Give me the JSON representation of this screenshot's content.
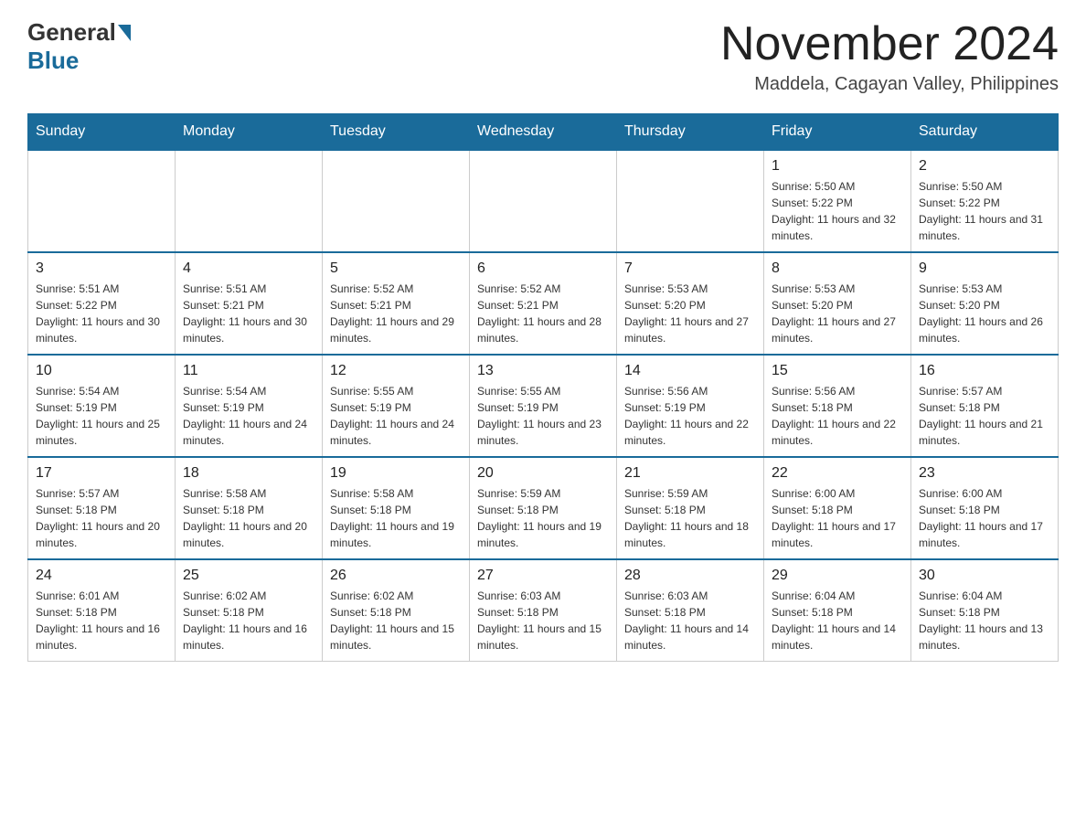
{
  "header": {
    "logo_general": "General",
    "logo_blue": "Blue",
    "month_title": "November 2024",
    "location": "Maddela, Cagayan Valley, Philippines"
  },
  "weekdays": [
    "Sunday",
    "Monday",
    "Tuesday",
    "Wednesday",
    "Thursday",
    "Friday",
    "Saturday"
  ],
  "weeks": [
    [
      {
        "day": "",
        "info": ""
      },
      {
        "day": "",
        "info": ""
      },
      {
        "day": "",
        "info": ""
      },
      {
        "day": "",
        "info": ""
      },
      {
        "day": "",
        "info": ""
      },
      {
        "day": "1",
        "info": "Sunrise: 5:50 AM\nSunset: 5:22 PM\nDaylight: 11 hours and 32 minutes."
      },
      {
        "day": "2",
        "info": "Sunrise: 5:50 AM\nSunset: 5:22 PM\nDaylight: 11 hours and 31 minutes."
      }
    ],
    [
      {
        "day": "3",
        "info": "Sunrise: 5:51 AM\nSunset: 5:22 PM\nDaylight: 11 hours and 30 minutes."
      },
      {
        "day": "4",
        "info": "Sunrise: 5:51 AM\nSunset: 5:21 PM\nDaylight: 11 hours and 30 minutes."
      },
      {
        "day": "5",
        "info": "Sunrise: 5:52 AM\nSunset: 5:21 PM\nDaylight: 11 hours and 29 minutes."
      },
      {
        "day": "6",
        "info": "Sunrise: 5:52 AM\nSunset: 5:21 PM\nDaylight: 11 hours and 28 minutes."
      },
      {
        "day": "7",
        "info": "Sunrise: 5:53 AM\nSunset: 5:20 PM\nDaylight: 11 hours and 27 minutes."
      },
      {
        "day": "8",
        "info": "Sunrise: 5:53 AM\nSunset: 5:20 PM\nDaylight: 11 hours and 27 minutes."
      },
      {
        "day": "9",
        "info": "Sunrise: 5:53 AM\nSunset: 5:20 PM\nDaylight: 11 hours and 26 minutes."
      }
    ],
    [
      {
        "day": "10",
        "info": "Sunrise: 5:54 AM\nSunset: 5:19 PM\nDaylight: 11 hours and 25 minutes."
      },
      {
        "day": "11",
        "info": "Sunrise: 5:54 AM\nSunset: 5:19 PM\nDaylight: 11 hours and 24 minutes."
      },
      {
        "day": "12",
        "info": "Sunrise: 5:55 AM\nSunset: 5:19 PM\nDaylight: 11 hours and 24 minutes."
      },
      {
        "day": "13",
        "info": "Sunrise: 5:55 AM\nSunset: 5:19 PM\nDaylight: 11 hours and 23 minutes."
      },
      {
        "day": "14",
        "info": "Sunrise: 5:56 AM\nSunset: 5:19 PM\nDaylight: 11 hours and 22 minutes."
      },
      {
        "day": "15",
        "info": "Sunrise: 5:56 AM\nSunset: 5:18 PM\nDaylight: 11 hours and 22 minutes."
      },
      {
        "day": "16",
        "info": "Sunrise: 5:57 AM\nSunset: 5:18 PM\nDaylight: 11 hours and 21 minutes."
      }
    ],
    [
      {
        "day": "17",
        "info": "Sunrise: 5:57 AM\nSunset: 5:18 PM\nDaylight: 11 hours and 20 minutes."
      },
      {
        "day": "18",
        "info": "Sunrise: 5:58 AM\nSunset: 5:18 PM\nDaylight: 11 hours and 20 minutes."
      },
      {
        "day": "19",
        "info": "Sunrise: 5:58 AM\nSunset: 5:18 PM\nDaylight: 11 hours and 19 minutes."
      },
      {
        "day": "20",
        "info": "Sunrise: 5:59 AM\nSunset: 5:18 PM\nDaylight: 11 hours and 19 minutes."
      },
      {
        "day": "21",
        "info": "Sunrise: 5:59 AM\nSunset: 5:18 PM\nDaylight: 11 hours and 18 minutes."
      },
      {
        "day": "22",
        "info": "Sunrise: 6:00 AM\nSunset: 5:18 PM\nDaylight: 11 hours and 17 minutes."
      },
      {
        "day": "23",
        "info": "Sunrise: 6:00 AM\nSunset: 5:18 PM\nDaylight: 11 hours and 17 minutes."
      }
    ],
    [
      {
        "day": "24",
        "info": "Sunrise: 6:01 AM\nSunset: 5:18 PM\nDaylight: 11 hours and 16 minutes."
      },
      {
        "day": "25",
        "info": "Sunrise: 6:02 AM\nSunset: 5:18 PM\nDaylight: 11 hours and 16 minutes."
      },
      {
        "day": "26",
        "info": "Sunrise: 6:02 AM\nSunset: 5:18 PM\nDaylight: 11 hours and 15 minutes."
      },
      {
        "day": "27",
        "info": "Sunrise: 6:03 AM\nSunset: 5:18 PM\nDaylight: 11 hours and 15 minutes."
      },
      {
        "day": "28",
        "info": "Sunrise: 6:03 AM\nSunset: 5:18 PM\nDaylight: 11 hours and 14 minutes."
      },
      {
        "day": "29",
        "info": "Sunrise: 6:04 AM\nSunset: 5:18 PM\nDaylight: 11 hours and 14 minutes."
      },
      {
        "day": "30",
        "info": "Sunrise: 6:04 AM\nSunset: 5:18 PM\nDaylight: 11 hours and 13 minutes."
      }
    ]
  ]
}
